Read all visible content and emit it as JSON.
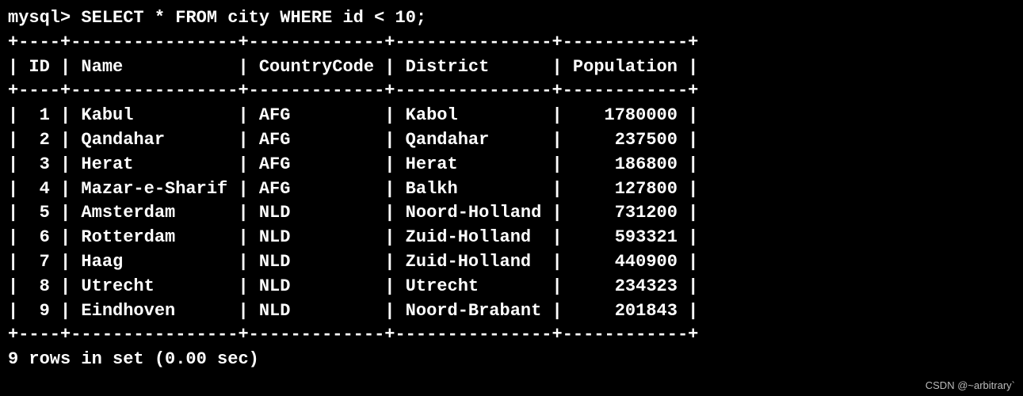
{
  "prompt": "mysql>",
  "query": "SELECT * FROM city WHERE id < 10;",
  "table": {
    "columns": [
      {
        "name": "ID",
        "width": 4,
        "align": "right"
      },
      {
        "name": "Name",
        "width": 16,
        "align": "left"
      },
      {
        "name": "CountryCode",
        "width": 13,
        "align": "left"
      },
      {
        "name": "District",
        "width": 15,
        "align": "left"
      },
      {
        "name": "Population",
        "width": 12,
        "align": "right"
      }
    ],
    "rows": [
      {
        "ID": "1",
        "Name": "Kabul",
        "CountryCode": "AFG",
        "District": "Kabol",
        "Population": "1780000"
      },
      {
        "ID": "2",
        "Name": "Qandahar",
        "CountryCode": "AFG",
        "District": "Qandahar",
        "Population": "237500"
      },
      {
        "ID": "3",
        "Name": "Herat",
        "CountryCode": "AFG",
        "District": "Herat",
        "Population": "186800"
      },
      {
        "ID": "4",
        "Name": "Mazar-e-Sharif",
        "CountryCode": "AFG",
        "District": "Balkh",
        "Population": "127800"
      },
      {
        "ID": "5",
        "Name": "Amsterdam",
        "CountryCode": "NLD",
        "District": "Noord-Holland",
        "Population": "731200"
      },
      {
        "ID": "6",
        "Name": "Rotterdam",
        "CountryCode": "NLD",
        "District": "Zuid-Holland",
        "Population": "593321"
      },
      {
        "ID": "7",
        "Name": "Haag",
        "CountryCode": "NLD",
        "District": "Zuid-Holland",
        "Population": "440900"
      },
      {
        "ID": "8",
        "Name": "Utrecht",
        "CountryCode": "NLD",
        "District": "Utrecht",
        "Population": "234323"
      },
      {
        "ID": "9",
        "Name": "Eindhoven",
        "CountryCode": "NLD",
        "District": "Noord-Brabant",
        "Population": "201843"
      }
    ]
  },
  "summary": "9 rows in set (0.00 sec)",
  "watermark": "CSDN @~arbitrary`"
}
